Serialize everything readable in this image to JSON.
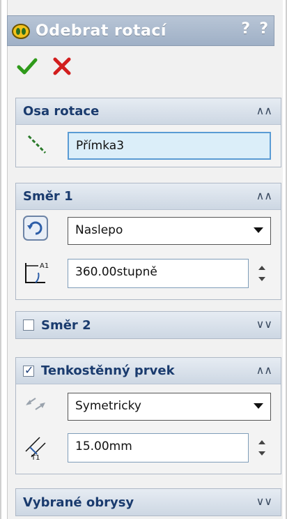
{
  "header": {
    "title": "Odebrat rotací",
    "help_primary": "?",
    "help_secondary": "?"
  },
  "actions": {
    "ok_icon": "green-check-icon",
    "cancel_icon": "red-x-icon"
  },
  "groups": {
    "axis": {
      "title": "Osa rotace",
      "value": "Přímka3",
      "icon": "axis-line-icon"
    },
    "dir1": {
      "title": "Směr 1",
      "type_value": "Naslepo",
      "angle_value": "360.00stupně",
      "angle_icon_label": "A1"
    },
    "dir2": {
      "title": "Směr 2",
      "checked": false
    },
    "thin": {
      "title": "Tenkostěnný prvek",
      "checked": true,
      "type_value": "Symetricky",
      "thickness_value": "15.00mm",
      "thickness_icon_label": "T1"
    },
    "contours": {
      "title": "Vybrané obrysy"
    }
  },
  "colors": {
    "header_bg": "#a9b9cd",
    "group_title": "#1a3b6e",
    "ok": "#2f9a1a",
    "cancel": "#d21e1e"
  }
}
